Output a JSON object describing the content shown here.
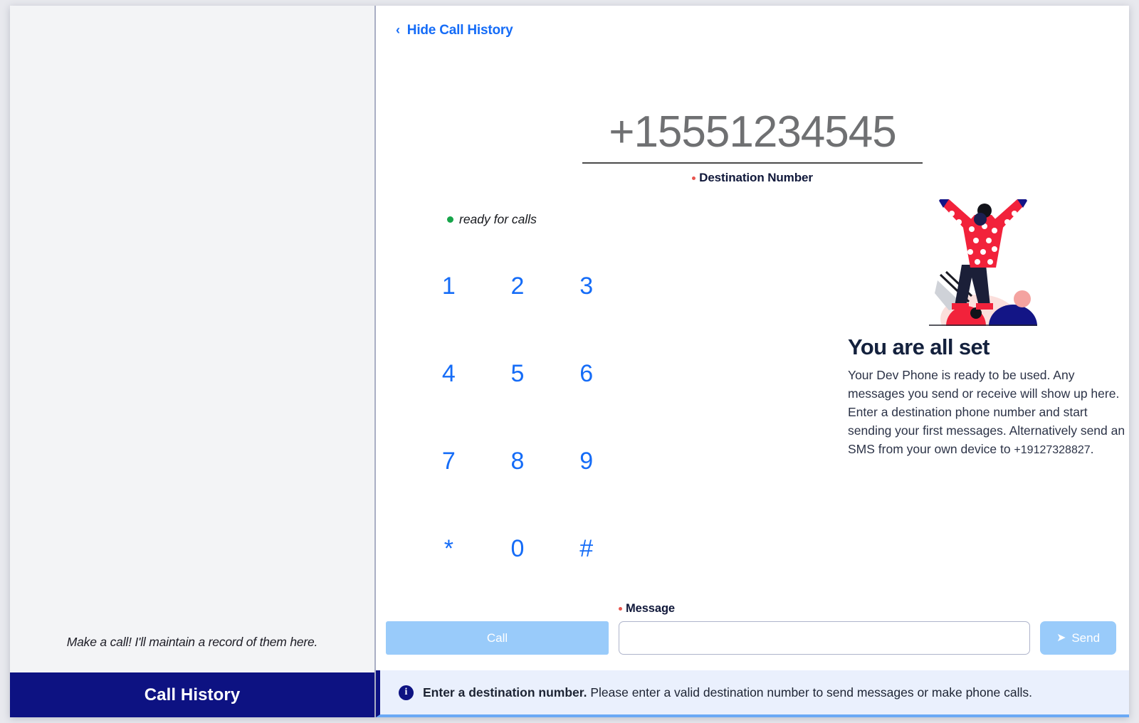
{
  "sidebar": {
    "empty_text": "Make a call! I'll maintain a record of them here.",
    "footer_label": "Call History"
  },
  "main": {
    "hide_history_label": "Hide Call History",
    "hide_history_chevron": "‹",
    "destination": {
      "value": "+15551234545",
      "label": "Destination Number",
      "required_marker": "•"
    },
    "status": {
      "text": "ready for calls",
      "dot_color": "#17a54a"
    },
    "dialpad": {
      "keys": [
        "1",
        "2",
        "3",
        "4",
        "5",
        "6",
        "7",
        "8",
        "9",
        "*",
        "0",
        "#"
      ]
    },
    "allset": {
      "title": "You are all set",
      "body_lead": "Your Dev Phone is ready to be used. Any messages you send or receive will show up here. Enter a destination phone number and start sending your first messages. Alternatively send an SMS from your own device to ",
      "body_number": "+19127328827",
      "body_tail": "."
    },
    "actions": {
      "call_label": "Call",
      "message_label": "Message",
      "message_value": "",
      "message_placeholder": "",
      "send_label": "Send",
      "send_icon": "➤"
    },
    "alert": {
      "icon_glyph": "i",
      "strong": "Enter a destination number.",
      "text": " Please enter a valid destination number to send messages or make phone calls."
    }
  },
  "colors": {
    "brand_navy": "#0D1282",
    "link_blue": "#156CF7",
    "button_light_blue": "#99CBFA",
    "required_red": "#E8554E",
    "status_green": "#17A54A",
    "alert_bg": "#EAF0FD"
  }
}
